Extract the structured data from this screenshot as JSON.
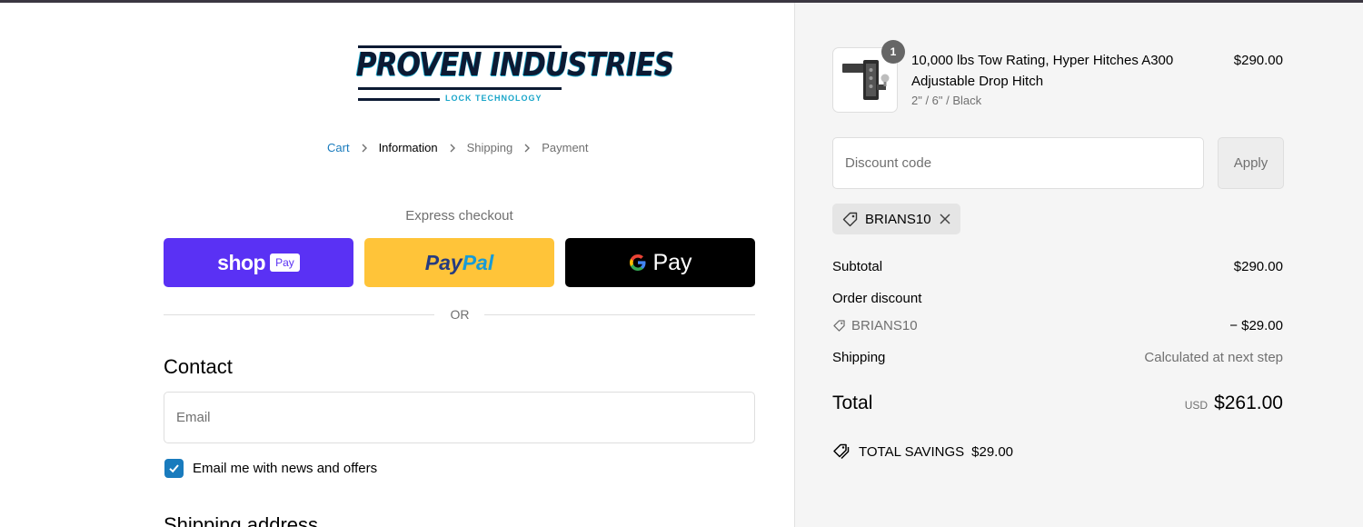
{
  "brand": {
    "logo_text": "PROVEN INDUSTRIES",
    "logo_subtext": "LOCK TECHNOLOGY"
  },
  "breadcrumb": [
    "Cart",
    "Information",
    "Shipping",
    "Payment"
  ],
  "express": {
    "label": "Express checkout",
    "shop_word": "shop",
    "shop_pay": "Pay",
    "paypal_pay": "Pay",
    "paypal_pal": "Pal",
    "gpay_word": "Pay"
  },
  "divider": "OR",
  "contact": {
    "title": "Contact",
    "email_placeholder": "Email",
    "newsletter_label": "Email me with news and offers",
    "newsletter_checked": true
  },
  "shipping_address_title": "Shipping address",
  "order": {
    "quantity": "1",
    "product_name": "10,000 lbs Tow Rating, Hyper Hitches A300 Adjustable Drop Hitch",
    "variant": "2\" / 6\" / Black",
    "price": "$290.00"
  },
  "discount": {
    "placeholder": "Discount code",
    "apply_label": "Apply",
    "applied_code": "BRIANS10"
  },
  "summary": {
    "subtotal_label": "Subtotal",
    "subtotal_value": "$290.00",
    "order_discount_label": "Order discount",
    "discount_code": "BRIANS10",
    "discount_value": "− $29.00",
    "shipping_label": "Shipping",
    "shipping_value": "Calculated at next step",
    "total_label": "Total",
    "currency": "USD",
    "total_value": "$261.00",
    "savings_label": "TOTAL SAVINGS",
    "savings_value": "$29.00"
  },
  "colors": {
    "shop_pay": "#5a31f4",
    "paypal": "#ffc439",
    "gpay": "#000000",
    "accent": "#197bbd"
  }
}
